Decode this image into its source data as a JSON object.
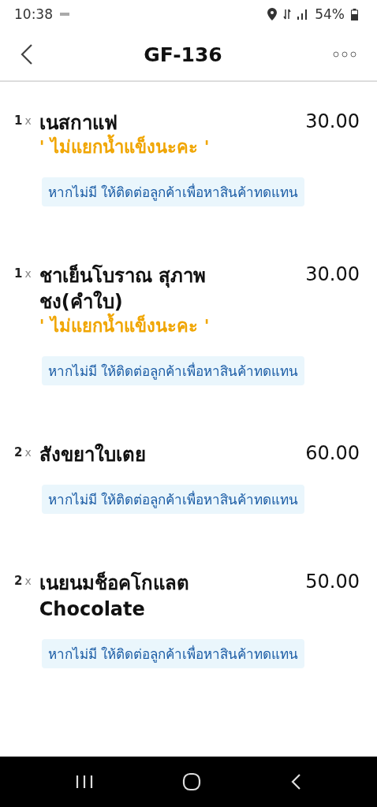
{
  "status_bar": {
    "time": "10:38",
    "battery": "54%"
  },
  "header": {
    "title": "GF-136"
  },
  "items": [
    {
      "qty": "1",
      "times": "x",
      "name": "เนสกาแฟ",
      "price": "30.00",
      "note": "' ไม่แยกน้ำแข็งนะคะ '",
      "substitute": "หากไม่มี ให้ติดต่อลูกค้าเพื่อหาสินค้าทดแทน"
    },
    {
      "qty": "1",
      "times": "x",
      "name": "ชาเย็นโบราณ สุภาพชง(คำใบ)",
      "price": "30.00",
      "note": "' ไม่แยกน้ำแข็งนะคะ '",
      "substitute": "หากไม่มี ให้ติดต่อลูกค้าเพื่อหาสินค้าทดแทน"
    },
    {
      "qty": "2",
      "times": "x",
      "name": "สังขยาใบเตย",
      "price": "60.00",
      "substitute": "หากไม่มี ให้ติดต่อลูกค้าเพื่อหาสินค้าทดแทน"
    },
    {
      "qty": "2",
      "times": "x",
      "name": "เนยนมช็อคโกแลต Chocolate",
      "price": "50.00",
      "substitute": "หากไม่มี ให้ติดต่อลูกค้าเพื่อหาสินค้าทดแทน"
    }
  ]
}
